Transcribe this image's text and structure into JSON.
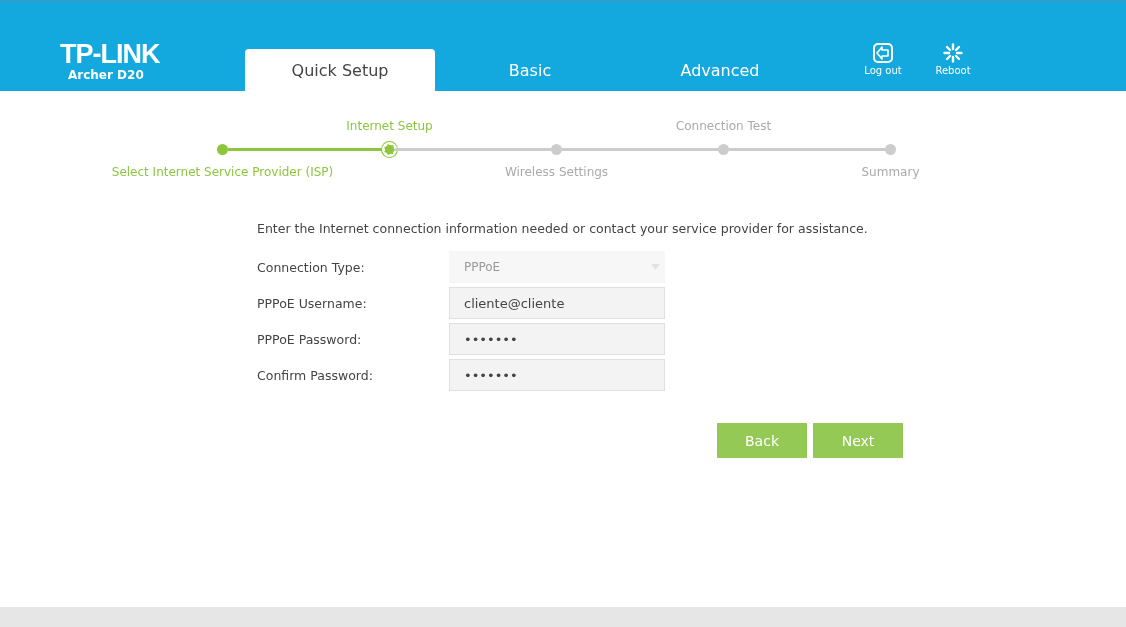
{
  "header": {
    "brand": "TP-LINK",
    "model": "Archer D20",
    "tabs": [
      {
        "label": "Quick Setup",
        "selected": true
      },
      {
        "label": "Basic",
        "selected": false
      },
      {
        "label": "Advanced",
        "selected": false
      }
    ],
    "actions": [
      {
        "kind": "logout",
        "label": "Log out"
      },
      {
        "kind": "reboot",
        "label": "Reboot"
      }
    ]
  },
  "steps": [
    {
      "label": "Select Internet Service Provider (ISP)",
      "completed": true,
      "selected": false
    },
    {
      "label": "Internet Setup",
      "completed": false,
      "selected": true
    },
    {
      "label": "Wireless Settings",
      "completed": false,
      "selected": false
    },
    {
      "label": "Connection Test",
      "completed": false,
      "selected": false
    },
    {
      "label": "Summary",
      "completed": false,
      "selected": false
    }
  ],
  "form": {
    "intro": "Enter the Internet connection information needed or contact your service provider for assistance.",
    "fields": [
      {
        "kind": "select",
        "label": "Connection Type:",
        "value": "PPPoE",
        "disabled": true
      },
      {
        "kind": "text",
        "label": "PPPoE Username:",
        "value": "cliente@cliente",
        "disabled": false
      },
      {
        "kind": "password",
        "label": "PPPoE Password:",
        "value": "•••••••",
        "disabled": false
      },
      {
        "kind": "password",
        "label": "Confirm Password:",
        "value": "•••••••",
        "disabled": false
      }
    ],
    "buttons": [
      "Back",
      "Next"
    ]
  }
}
